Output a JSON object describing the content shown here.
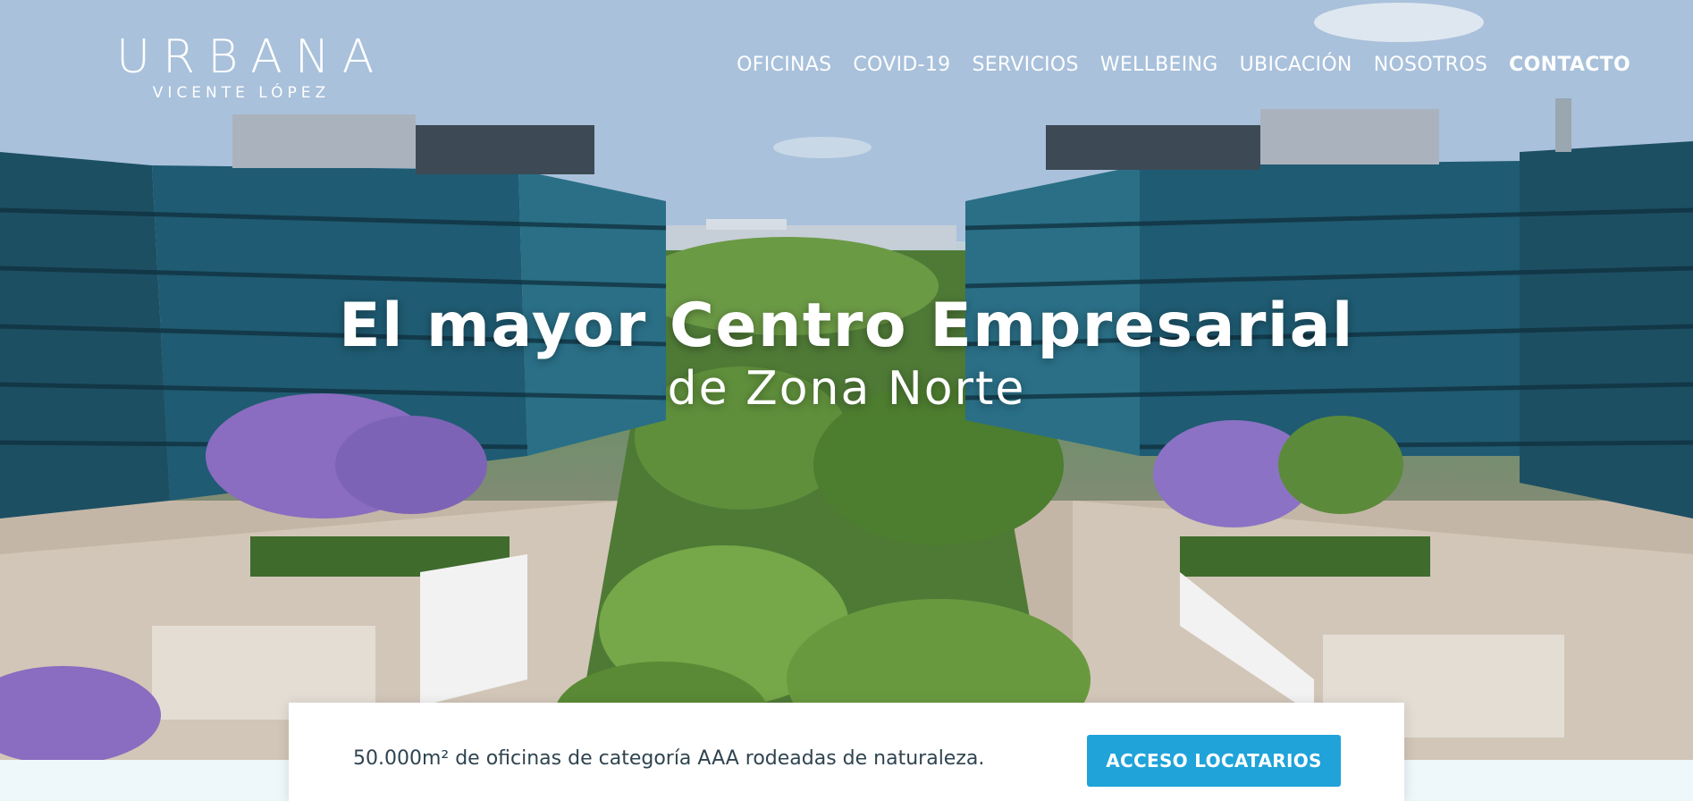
{
  "logo": {
    "name": "URBANA",
    "subtitle": "VICENTE LÓPEZ"
  },
  "nav": {
    "items": [
      "OFICINAS",
      "COVID-19",
      "SERVICIOS",
      "WELLBEING",
      "UBICACIÓN",
      "NOSOTROS",
      "CONTACTO"
    ]
  },
  "hero": {
    "title": "El mayor Centro Empresarial",
    "subtitle": "de Zona Norte"
  },
  "info_card": {
    "tagline": "50.000m² de oficinas de categoría AAA rodeadas de naturaleza.",
    "button": "ACCESO LOCATARIOS"
  },
  "colors": {
    "accent": "#1fa3d9",
    "text_dark": "#2f4450"
  }
}
